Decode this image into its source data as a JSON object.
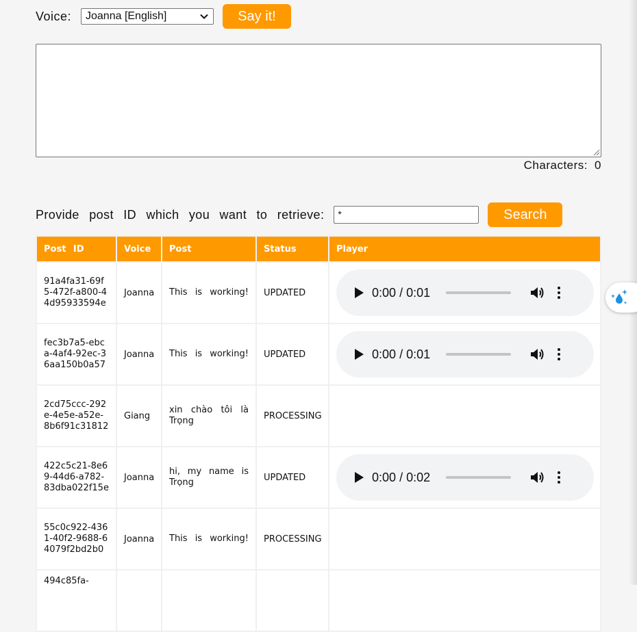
{
  "voice": {
    "label": "Voice:",
    "selected": "Joanna [English]"
  },
  "say_button": "Say it!",
  "textarea": {
    "value": ""
  },
  "characters": {
    "label": "Characters:",
    "count": "0"
  },
  "search": {
    "label": "Provide post ID which you want to retrieve:",
    "value": "*",
    "button": "Search"
  },
  "table": {
    "headers": [
      "Post ID",
      "Voice",
      "Post",
      "Status",
      "Player"
    ],
    "rows": [
      {
        "id": "91a4fa31-69f5-472f-a800-44d95933594e",
        "voice": "Joanna",
        "post": "This is working!",
        "status": "UPDATED",
        "player": {
          "current": "0:00",
          "sep": "/",
          "duration": "0:01"
        }
      },
      {
        "id": "fec3b7a5-ebca-4af4-92ec-36aa150b0a57",
        "voice": "Joanna",
        "post": "This is working!",
        "status": "UPDATED",
        "player": {
          "current": "0:00",
          "sep": "/",
          "duration": "0:01"
        }
      },
      {
        "id": "2cd75ccc-292e-4e5e-a52e-8b6f91c31812",
        "voice": "Giang",
        "post": "xin chào tôi là Trọng",
        "status": "PROCESSING"
      },
      {
        "id": "422c5c21-8e69-44d6-a782-83dba022f15e",
        "voice": "Joanna",
        "post": "hi, my name is Trọng",
        "status": "UPDATED",
        "player": {
          "current": "0:00",
          "sep": "/",
          "duration": "0:02"
        }
      },
      {
        "id": "55c0c922-4361-40f2-9688-64079f2bd2b0",
        "voice": "Joanna",
        "post": "This is working!",
        "status": "PROCESSING"
      },
      {
        "id": "494c85fa-",
        "voice": "",
        "post": "",
        "status": ""
      }
    ]
  },
  "icons": {
    "play": "play-icon",
    "volume": "volume-icon",
    "more": "more-vertical-icon",
    "fab": "water-drop-sparkle-icon"
  },
  "colors": {
    "accent": "#ff9900",
    "player_bg": "#f1f3f4"
  }
}
